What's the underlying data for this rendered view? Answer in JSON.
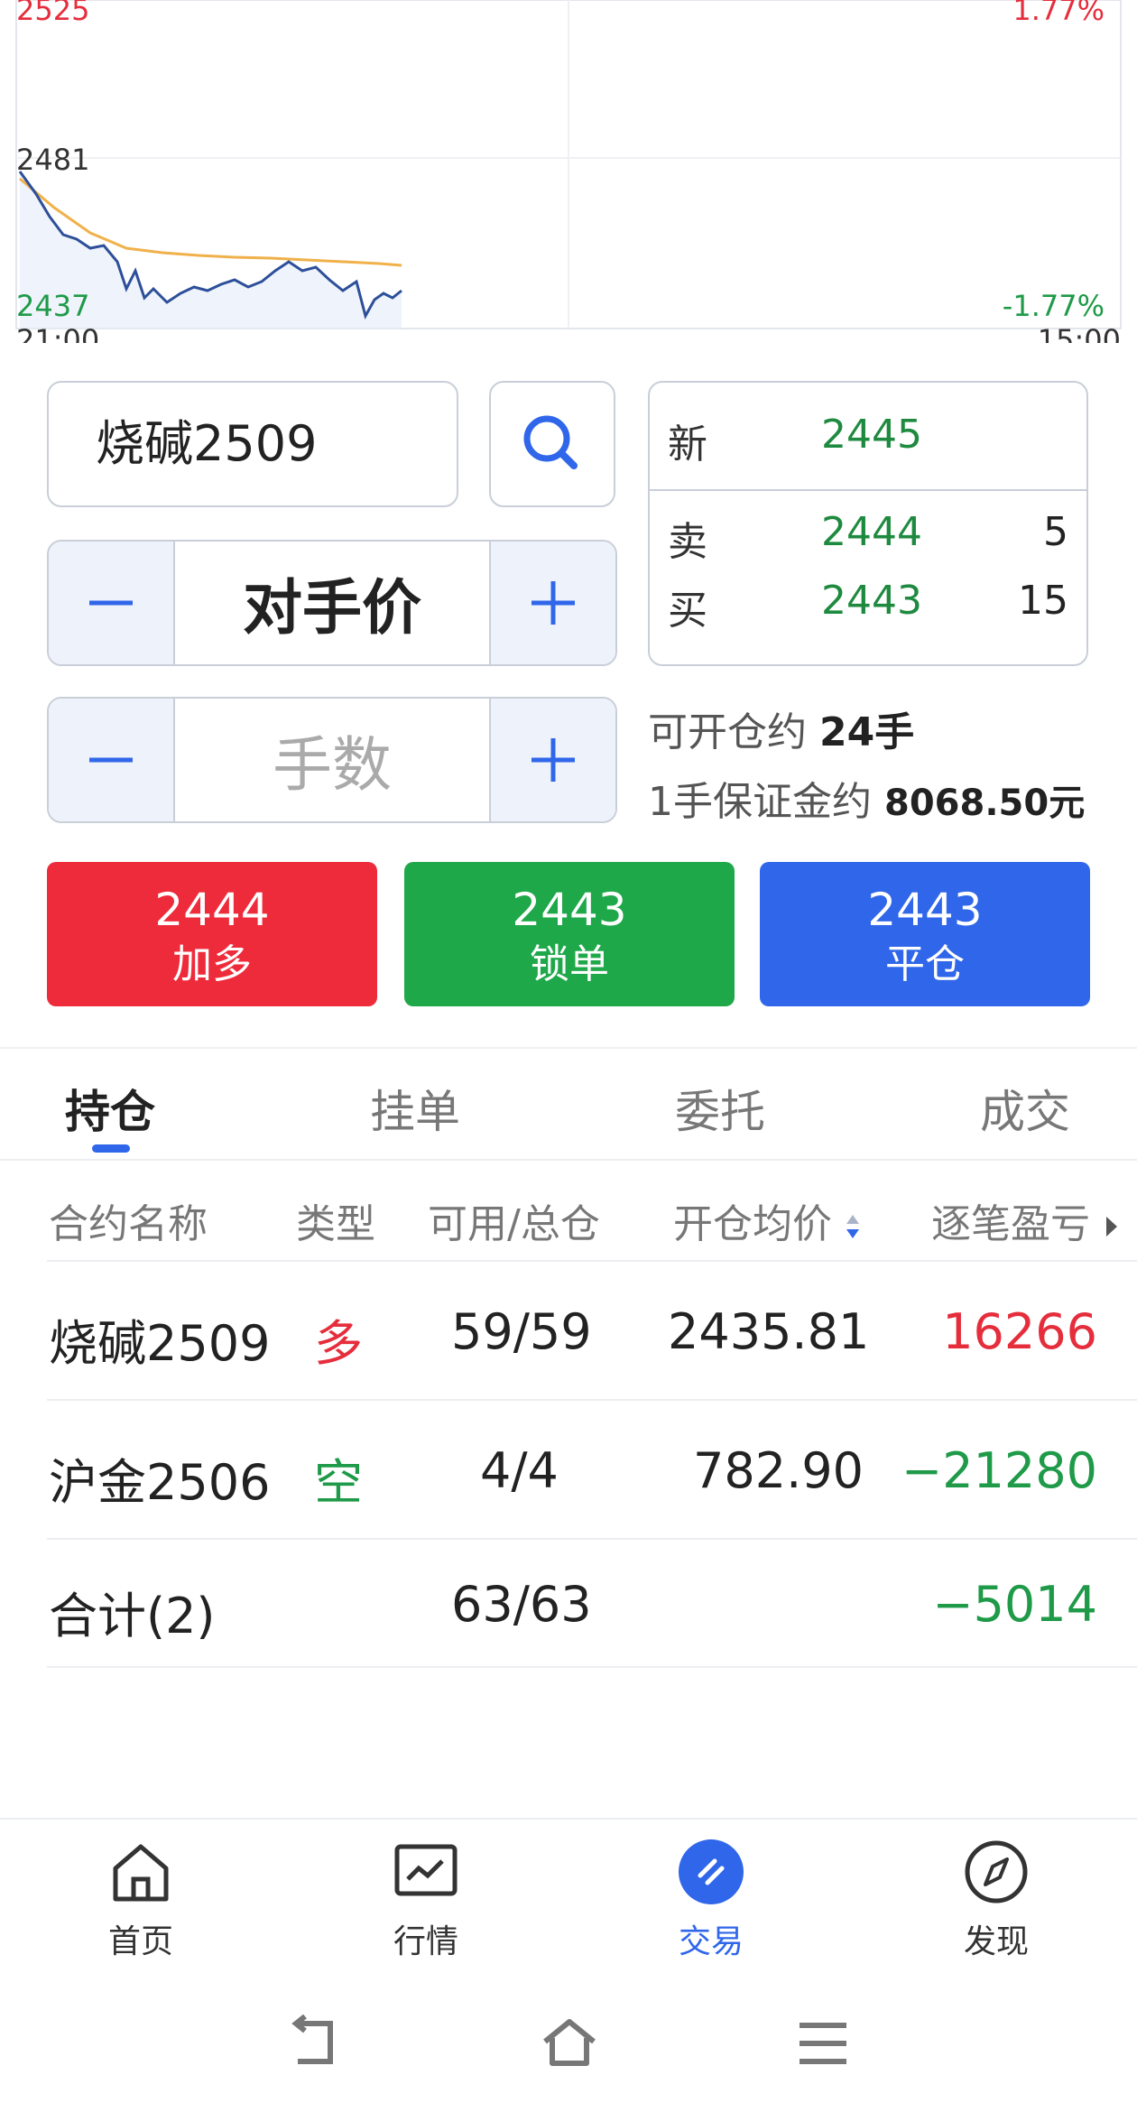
{
  "chart": {
    "price_high": "2525",
    "price_mid": "2481",
    "price_low": "2437",
    "pct_high": "1.77%",
    "pct_low": "-1.77%",
    "time_start": "21:00",
    "time_end": "15:00",
    "colors": {
      "up": "#e52d3c",
      "down": "#1e9a48",
      "price_line": "#2d4f9a",
      "avg_line": "#f0b14a"
    }
  },
  "order": {
    "symbol": "烧碱2509",
    "price_mode": "对手价",
    "qty_placeholder": "手数",
    "minus": "−",
    "plus": "+"
  },
  "quote": {
    "last_label": "新",
    "last_price": "2445",
    "ask_label": "卖",
    "ask_price": "2444",
    "ask_vol": "5",
    "bid_label": "买",
    "bid_price": "2443",
    "bid_vol": "15"
  },
  "info": {
    "open_label": "可开仓约",
    "open_value": "24手",
    "margin_label": "1手保证金约",
    "margin_value": "8068.50元"
  },
  "actions": [
    {
      "price": "2444",
      "label": "加多",
      "color": "#ee2b3b"
    },
    {
      "price": "2443",
      "label": "锁单",
      "color": "#1fa84a"
    },
    {
      "price": "2443",
      "label": "平仓",
      "color": "#2f66ea"
    }
  ],
  "tabs": [
    "持仓",
    "挂单",
    "委托",
    "成交"
  ],
  "table": {
    "headers": [
      "合约名称",
      "类型",
      "可用/总仓",
      "开仓均价",
      "逐笔盈亏"
    ],
    "rows": [
      {
        "name": "烧碱2509",
        "type": "多",
        "qty": "59/59",
        "avg": "2435.81",
        "pnl": "16266"
      },
      {
        "name": "沪金2506",
        "type": "空",
        "qty": "4/4",
        "avg": "782.90",
        "pnl": "−21280"
      }
    ],
    "total": {
      "name": "合计(2)",
      "qty": "63/63",
      "pnl": "−5014"
    }
  },
  "nav": [
    {
      "label": "首页",
      "icon": "home-icon"
    },
    {
      "label": "行情",
      "icon": "chart-icon"
    },
    {
      "label": "交易",
      "icon": "trade-icon"
    },
    {
      "label": "发现",
      "icon": "compass-icon"
    }
  ]
}
